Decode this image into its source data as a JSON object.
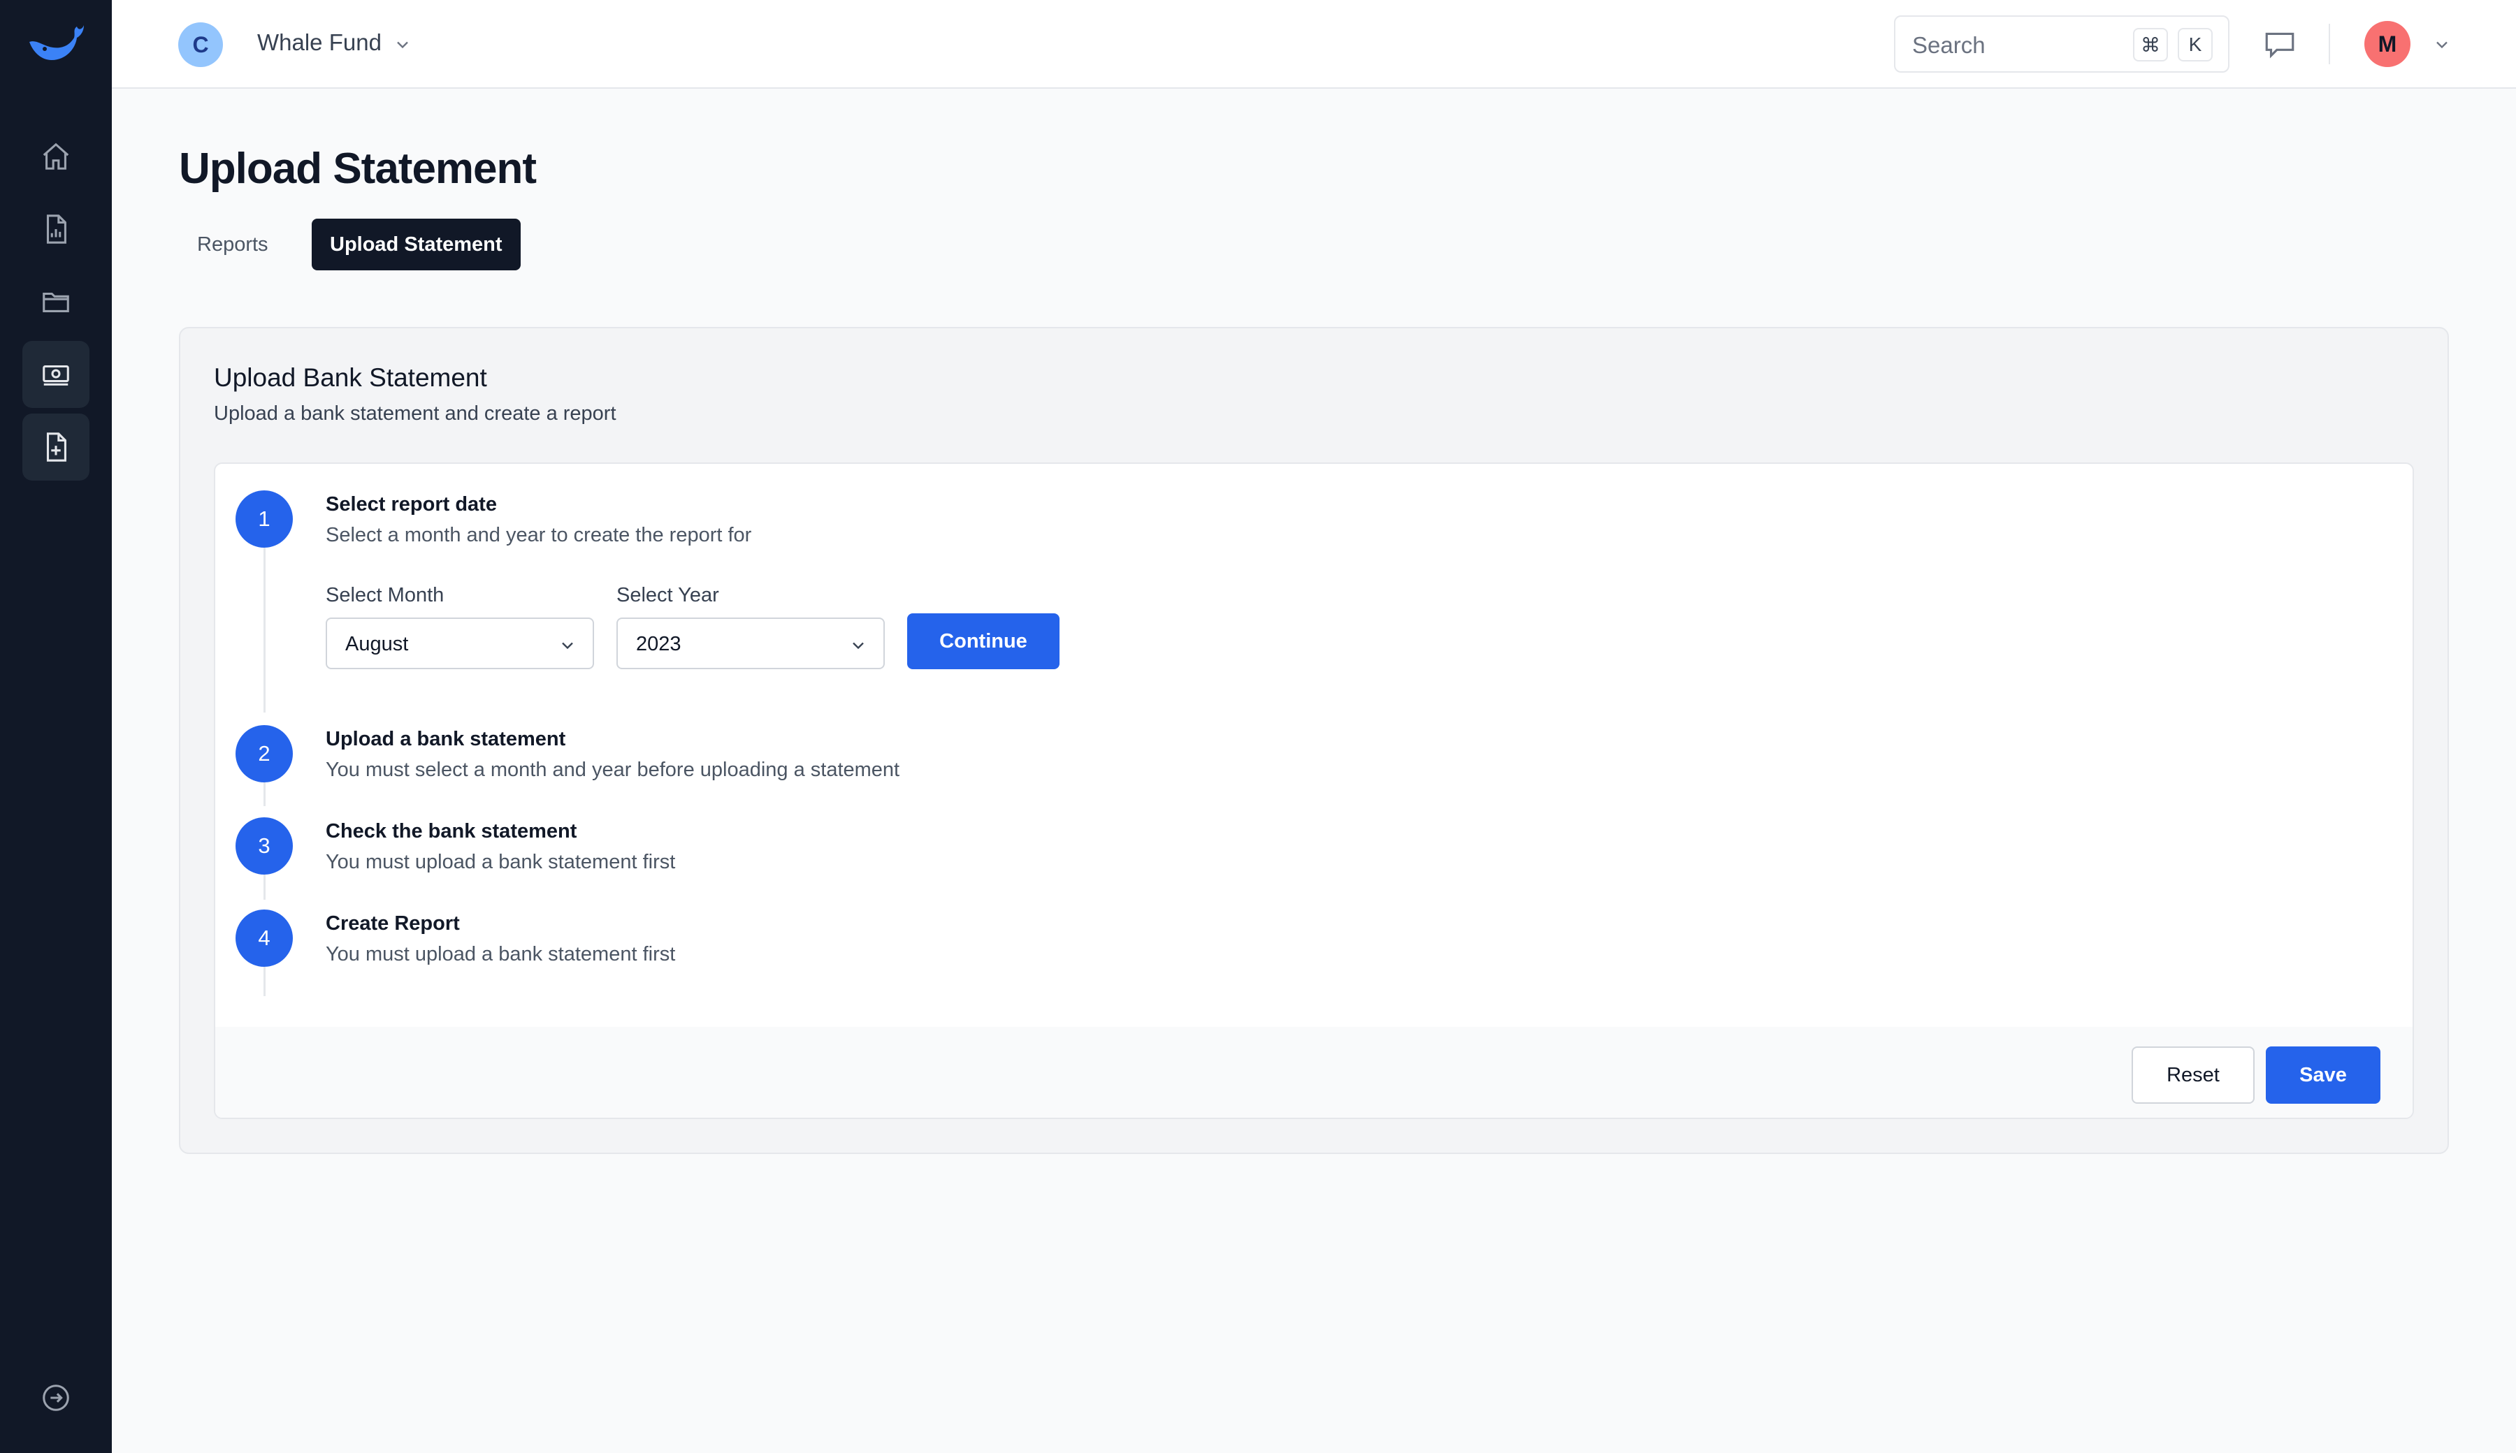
{
  "header": {
    "org_initial": "C",
    "org_name": "Whale Fund",
    "search_placeholder": "Search",
    "shortcut_modifier": "⌘",
    "shortcut_key": "K",
    "user_initial": "M"
  },
  "page": {
    "title": "Upload Statement",
    "tabs": [
      {
        "label": "Reports",
        "active": false
      },
      {
        "label": "Upload Statement",
        "active": true
      }
    ]
  },
  "card": {
    "title": "Upload Bank Statement",
    "subtitle": "Upload a bank statement and create a report"
  },
  "steps": [
    {
      "number": "1",
      "title": "Select report date",
      "description": "Select a month and year to create the report for"
    },
    {
      "number": "2",
      "title": "Upload a bank statement",
      "description": "You must select a month and year before uploading a statement"
    },
    {
      "number": "3",
      "title": "Check the bank statement",
      "description": "You must upload a bank statement first"
    },
    {
      "number": "4",
      "title": "Create Report",
      "description": "You must upload a bank statement first"
    }
  ],
  "form": {
    "month_label": "Select Month",
    "month_value": "August",
    "year_label": "Select Year",
    "year_value": "2023",
    "continue_label": "Continue"
  },
  "footer": {
    "reset_label": "Reset",
    "save_label": "Save"
  },
  "colors": {
    "sidebar": "#111827",
    "primary": "#2563eb",
    "org_avatar": "#93c5fd",
    "user_avatar": "#f87171"
  }
}
